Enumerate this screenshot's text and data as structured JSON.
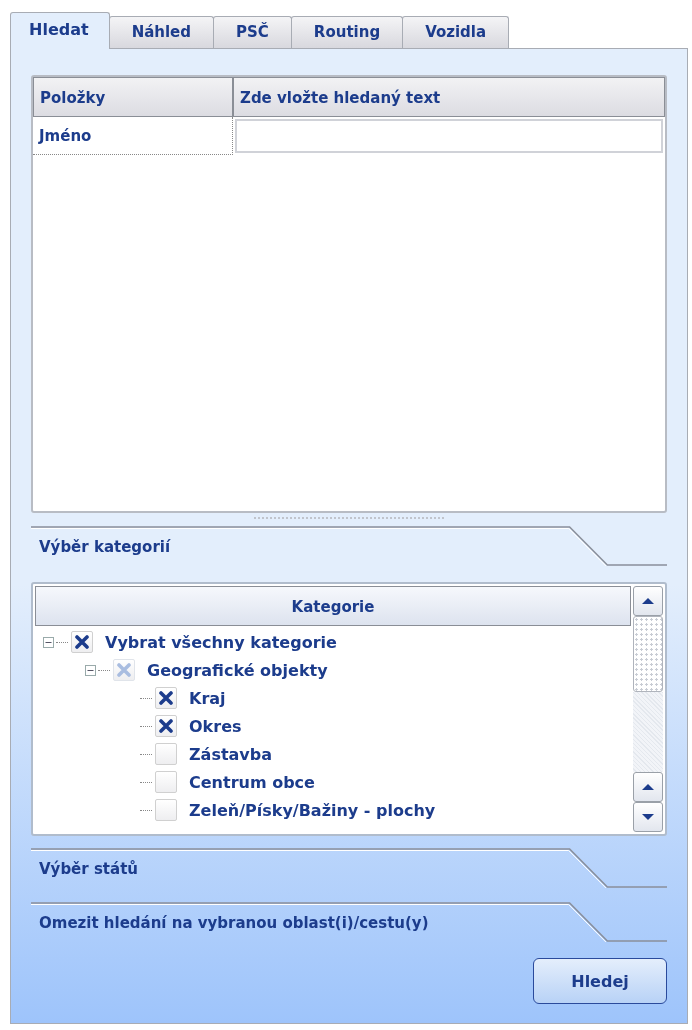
{
  "tabs": [
    {
      "label": "Hledat",
      "selected": true
    },
    {
      "label": "Náhled",
      "selected": false
    },
    {
      "label": "PSČ",
      "selected": false
    },
    {
      "label": "Routing",
      "selected": false
    },
    {
      "label": "Vozidla",
      "selected": false
    }
  ],
  "grid": {
    "columns": [
      "Položky",
      "Zde vložte hledaný text"
    ],
    "rows": [
      {
        "label": "Jméno"
      }
    ]
  },
  "category_section": {
    "title": "Výběr kategorií"
  },
  "category_tree": {
    "column": "Kategorie",
    "items": [
      {
        "label": "Vybrat všechny kategorie",
        "checked": true,
        "partial": false,
        "expanded": true,
        "children": [
          {
            "label": "Geografické objekty",
            "checked": true,
            "partial": true,
            "expanded": true,
            "children": [
              {
                "label": "Kraj",
                "checked": true,
                "partial": false
              },
              {
                "label": "Okres",
                "checked": true,
                "partial": false
              },
              {
                "label": "Zástavba",
                "checked": false,
                "partial": false
              },
              {
                "label": "Centrum obce",
                "checked": false,
                "partial": false
              },
              {
                "label": "Zeleň/Písky/Bažiny - plochy",
                "checked": false,
                "partial": false
              }
            ]
          }
        ]
      }
    ]
  },
  "sections": [
    {
      "title": "Výběr států"
    },
    {
      "title": "Omezit hledání na vybranou oblast(i)/cestu(y)"
    }
  ],
  "search_button": "Hledej"
}
